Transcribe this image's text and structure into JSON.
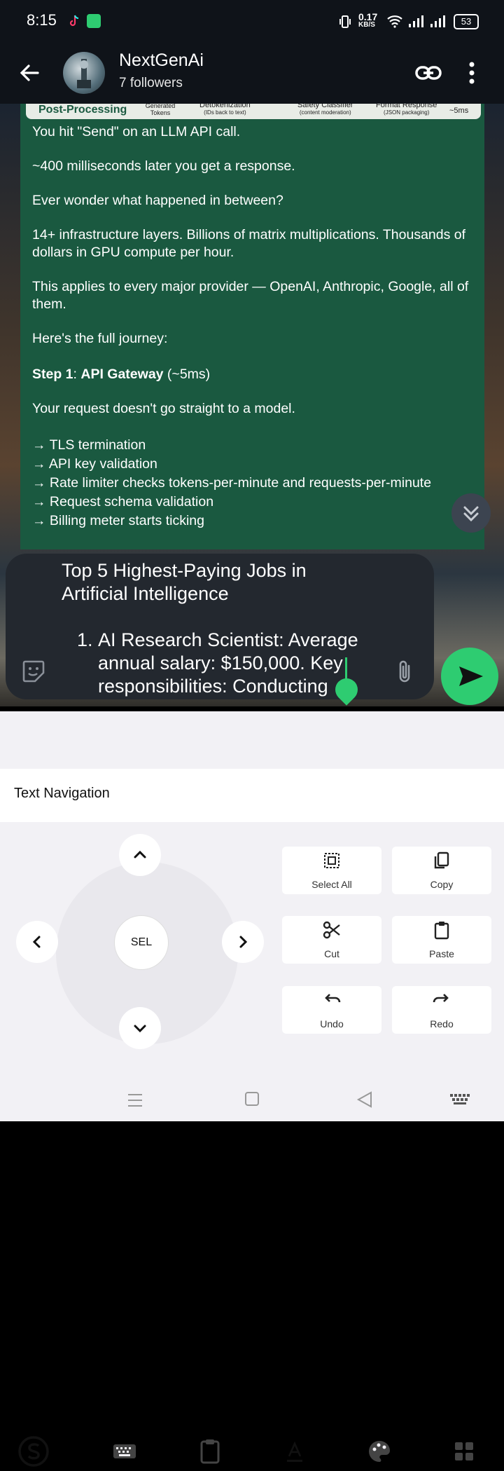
{
  "status": {
    "time": "8:15",
    "net_speed_value": "0.17",
    "net_speed_unit": "KB/S",
    "battery": "53"
  },
  "header": {
    "title": "NextGenAi",
    "subtitle": "7 followers"
  },
  "image_strip": {
    "left": "Post-Processing",
    "a": "Generated Tokens",
    "b": "Detokenization",
    "b2": "(IDs back to text)",
    "c": "Safety Classifier",
    "c2": "(content moderation)",
    "d": "Format Response",
    "d2": "(JSON packaging)",
    "e": "~5ms"
  },
  "message": {
    "p1": "You hit \"Send\" on an LLM API call.",
    "p2": "~400 milliseconds later you get a response.",
    "p3": "Ever wonder what happened in between?",
    "p4": "14+ infrastructure layers. Billions of matrix multiplications. Thousands of dollars in GPU compute per hour.",
    "p5": "This applies to every major provider — OpenAI, Anthropic, Google, all of them.",
    "p6": "Here's the full journey:",
    "step_prefix": "Step 1",
    "step_name": "API Gateway",
    "step_time": " (~5ms)",
    "p7": "Your request doesn't go straight to a model.",
    "bullets": [
      "→ TLS termination",
      "→ API key validation",
      "→ Rate limiter checks tokens-per-minute and requests-per-minute",
      "→ Request schema validation",
      "→ Billing meter starts ticking"
    ]
  },
  "composer": {
    "line1": "Top 5 Highest-Paying Jobs in",
    "line2": "Artificial Intelligence",
    "item_num": "1.",
    "item_l1": "AI Research Scientist: Average",
    "item_l2": "annual salary: $150,000. Key",
    "item_l3": "responsibilities: Conducting"
  },
  "keyboard": {
    "section_title": "Text Navigation",
    "sel_label": "SEL",
    "actions": {
      "select_all": "Select All",
      "copy": "Copy",
      "cut": "Cut",
      "paste": "Paste",
      "undo": "Undo",
      "redo": "Redo"
    }
  },
  "colors": {
    "bubble": "#1a5940",
    "accent": "#2ecc71",
    "appbar": "#0f1319"
  }
}
